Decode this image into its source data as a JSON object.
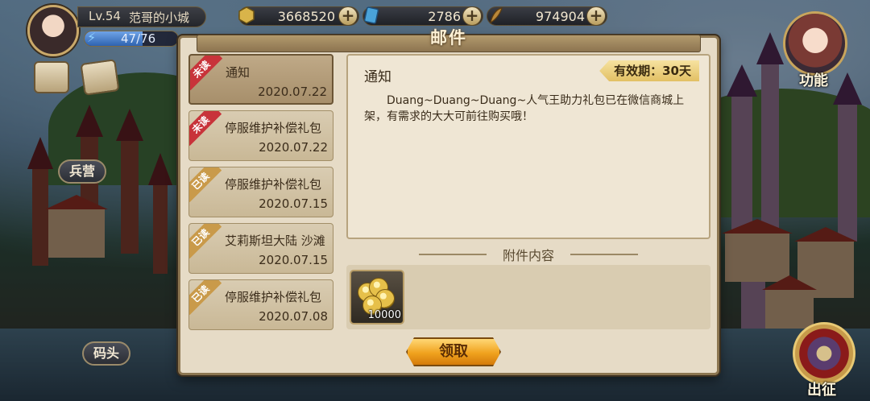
{
  "player": {
    "level": "Lv.54",
    "city_name": "范哥的小城",
    "energy_text": "47/76",
    "energy_fraction": 0.62
  },
  "resources": [
    {
      "name": "gold",
      "icon": "gold-ingot-icon",
      "value": "3668520"
    },
    {
      "name": "gems",
      "icon": "blue-gem-icon",
      "value": "2786"
    },
    {
      "name": "wood",
      "icon": "feather-icon",
      "value": "974904"
    }
  ],
  "map_labels": {
    "barracks": "兵营",
    "dock": "码头",
    "function": "功能",
    "expedition": "出征"
  },
  "mail": {
    "title": "邮件",
    "items": [
      {
        "status": "未读",
        "status_kind": "unread",
        "subject": "通知",
        "date": "2020.07.22",
        "selected": true
      },
      {
        "status": "未读",
        "status_kind": "unread",
        "subject": "停服维护补偿礼包",
        "date": "2020.07.22",
        "selected": false
      },
      {
        "status": "已读",
        "status_kind": "read",
        "subject": "停服维护补偿礼包",
        "date": "2020.07.15",
        "selected": false
      },
      {
        "status": "已读",
        "status_kind": "read",
        "subject": "艾莉斯坦大陆 沙滩",
        "date": "2020.07.15",
        "selected": false
      },
      {
        "status": "已读",
        "status_kind": "read",
        "subject": "停服维护补偿礼包",
        "date": "2020.07.08",
        "selected": false
      }
    ],
    "detail": {
      "title": "通知",
      "validity": "有效期：30天",
      "body": "Duang~Duang~Duang~人气王助力礼包已在微信商城上架，有需求的大大可前往购买哦！"
    },
    "attachments_header": "附件内容",
    "attachments": [
      {
        "icon": "gold-coins-icon",
        "quantity": "10000"
      }
    ],
    "claim_label": "领取"
  },
  "colors": {
    "unread_ribbon": "#c8333a",
    "read_ribbon": "#c99a4a",
    "claim_button": "#f0a21e",
    "panel_bg": "#e6dbc6"
  }
}
